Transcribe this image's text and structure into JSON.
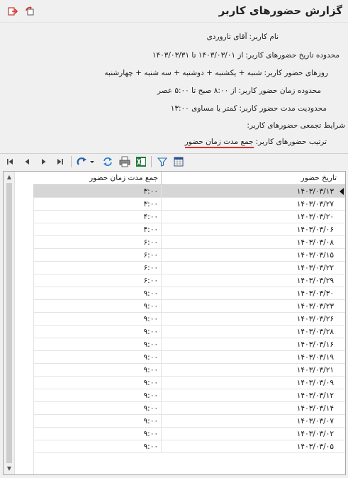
{
  "window": {
    "title": "گزارش حضورهای کاربر"
  },
  "info": {
    "user": {
      "label": "نام کاربر:",
      "value": "آقای تاروردی"
    },
    "date_range": {
      "label": "محدوده تاریخ حضورهای کاربر:",
      "value": "از ۱۴۰۳/۰۳/۰۱ تا ۱۴۰۳/۰۳/۳۱"
    },
    "days": {
      "label": "روزهای حضور کاربر:",
      "value": "شنبه + یکشنبه + دوشنبه + سه شنبه + چهارشنبه"
    },
    "time_range": {
      "label": "محدوده زمان حضور کاربر:",
      "value": "از ۸:۰۰ صبح تا ۵:۰۰ عصر"
    },
    "duration_limit": {
      "label": "محدودیت مدت حضور کاربر:",
      "value": "کمتر یا مساوی ۱۳:۰۰"
    },
    "aggregation": {
      "label": "شرایط تجمعی حضورهای کاربر:",
      "value": ""
    },
    "sort": {
      "label": "ترتیب حضورهای کاربر:",
      "value": "جمع مدت زمان حضور"
    }
  },
  "toolbar": {
    "icons": [
      "first-icon",
      "previous-icon",
      "next-icon",
      "last-icon",
      "redo-icon",
      "dropdown-icon",
      "refresh-icon",
      "print-icon",
      "excel-icon",
      "filter-icon",
      "grid-settings-icon"
    ]
  },
  "grid": {
    "columns": {
      "date": "تاریخ حضور",
      "total": "جمع مدت زمان حضور"
    },
    "rows": [
      {
        "date": "۱۴۰۳/۰۳/۱۳",
        "total": "۳:۰۰",
        "selected": true
      },
      {
        "date": "۱۴۰۳/۰۳/۲۷",
        "total": "۳:۰۰"
      },
      {
        "date": "۱۴۰۳/۰۳/۲۰",
        "total": "۴:۰۰"
      },
      {
        "date": "۱۴۰۳/۰۳/۰۶",
        "total": "۴:۰۰"
      },
      {
        "date": "۱۴۰۳/۰۳/۰۸",
        "total": "۶:۰۰"
      },
      {
        "date": "۱۴۰۳/۰۳/۱۵",
        "total": "۶:۰۰"
      },
      {
        "date": "۱۴۰۳/۰۳/۲۲",
        "total": "۶:۰۰"
      },
      {
        "date": "۱۴۰۳/۰۳/۲۹",
        "total": "۶:۰۰"
      },
      {
        "date": "۱۴۰۳/۰۳/۳۰",
        "total": "۹:۰۰"
      },
      {
        "date": "۱۴۰۳/۰۳/۲۳",
        "total": "۹:۰۰"
      },
      {
        "date": "۱۴۰۳/۰۳/۲۶",
        "total": "۹:۰۰"
      },
      {
        "date": "۱۴۰۳/۰۳/۲۸",
        "total": "۹:۰۰"
      },
      {
        "date": "۱۴۰۳/۰۳/۱۶",
        "total": "۹:۰۰"
      },
      {
        "date": "۱۴۰۳/۰۳/۱۹",
        "total": "۹:۰۰"
      },
      {
        "date": "۱۴۰۳/۰۳/۲۱",
        "total": "۹:۰۰"
      },
      {
        "date": "۱۴۰۳/۰۳/۰۹",
        "total": "۹:۰۰"
      },
      {
        "date": "۱۴۰۳/۰۳/۱۲",
        "total": "۹:۰۰"
      },
      {
        "date": "۱۴۰۳/۰۳/۱۴",
        "total": "۹:۰۰"
      },
      {
        "date": "۱۴۰۳/۰۳/۰۷",
        "total": "۹:۰۰"
      },
      {
        "date": "۱۴۰۳/۰۳/۰۲",
        "total": "۹:۰۰"
      },
      {
        "date": "۱۴۰۳/۰۳/۰۵",
        "total": "۹:۰۰"
      }
    ]
  }
}
